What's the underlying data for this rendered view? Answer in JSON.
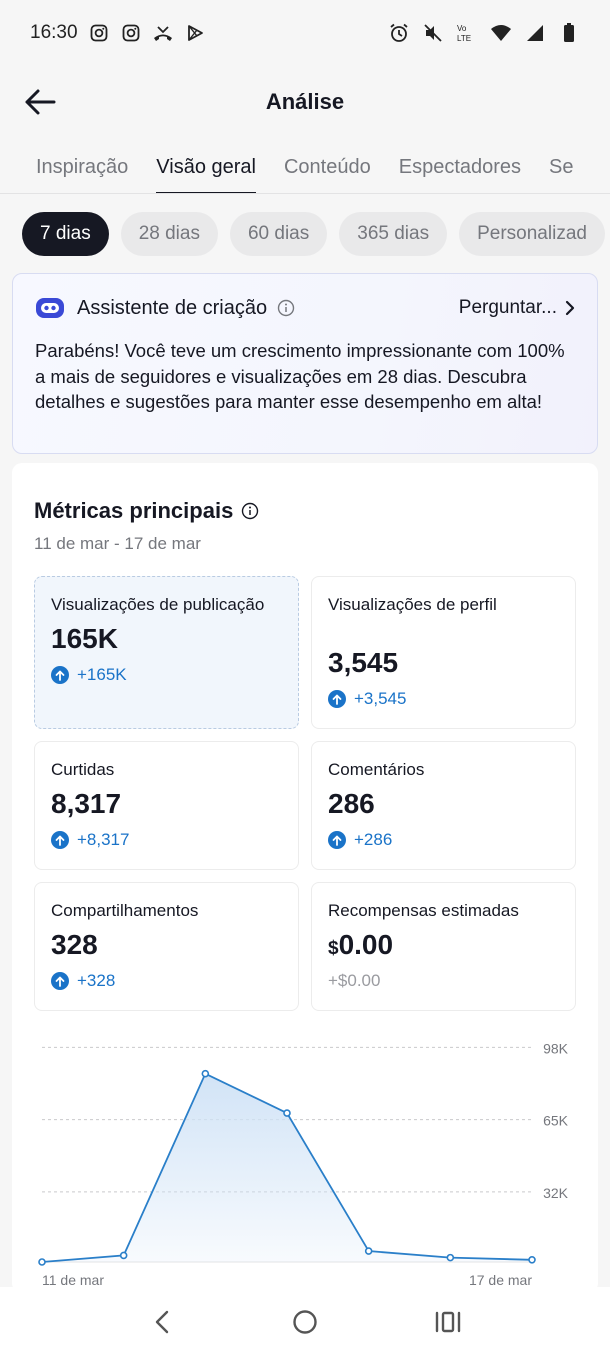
{
  "status_bar": {
    "time": "16:30"
  },
  "header": {
    "title": "Análise",
    "back_icon": "arrow-left-icon"
  },
  "tabs": [
    {
      "label": "Inspiração",
      "active": false
    },
    {
      "label": "Visão geral",
      "active": true
    },
    {
      "label": "Conteúdo",
      "active": false
    },
    {
      "label": "Espectadores",
      "active": false
    },
    {
      "label": "Se",
      "active": false
    }
  ],
  "time_filters": [
    {
      "label": "7 dias",
      "active": true
    },
    {
      "label": "28 dias",
      "active": false
    },
    {
      "label": "60 dias",
      "active": false
    },
    {
      "label": "365 dias",
      "active": false
    },
    {
      "label": "Personalizad",
      "active": false
    }
  ],
  "assistant": {
    "title": "Assistente de criação",
    "ask_label": "Perguntar...",
    "message": "Parabéns! Você teve um crescimento impressionante com 100% a mais de seguidores e visualizações em 28 dias. Descubra detalhes e sugestões para manter esse desempenho em alta!"
  },
  "metrics": {
    "title": "Métricas principais",
    "date_range": "11 de mar - 17 de mar",
    "items": [
      {
        "label": "Visualizações de publicação",
        "value": "165K",
        "change": "+165K"
      },
      {
        "label": "Visualizações de perfil",
        "value": "3,545",
        "change": "+3,545"
      },
      {
        "label": "Curtidas",
        "value": "8,317",
        "change": "+8,317"
      },
      {
        "label": "Comentários",
        "value": "286",
        "change": "+286"
      },
      {
        "label": "Compartilhamentos",
        "value": "328",
        "change": "+328"
      },
      {
        "label": "Recompensas estimadas",
        "currency": "$",
        "value": "0.00",
        "change": "+$0.00"
      }
    ]
  },
  "chart_data": {
    "type": "area",
    "title": "",
    "xlabel": "",
    "ylabel": "",
    "y_tick_labels": [
      "98K",
      "65K",
      "32K"
    ],
    "y_ticks": [
      98000,
      65000,
      32000
    ],
    "ylim": [
      0,
      100000
    ],
    "x_tick_labels": [
      "11 de mar",
      "17 de mar"
    ],
    "x": [
      "11 de mar",
      "12 de mar",
      "13 de mar",
      "14 de mar",
      "15 de mar",
      "16 de mar",
      "17 de mar"
    ],
    "values": [
      0,
      3000,
      86000,
      68000,
      5000,
      2000,
      1000
    ],
    "grid": true,
    "color": "#2a7fc9",
    "fill": "#cfe2f6"
  }
}
